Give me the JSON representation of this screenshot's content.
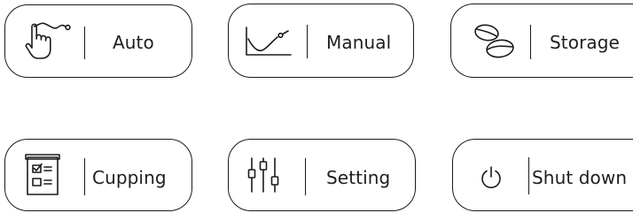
{
  "buttons": {
    "auto": {
      "label": "Auto",
      "icon": "touch-gesture-icon"
    },
    "manual": {
      "label": "Manual",
      "icon": "curve-graph-icon"
    },
    "storage": {
      "label": "Storage",
      "icon": "coffee-beans-icon"
    },
    "cupping": {
      "label": "Cupping",
      "icon": "checklist-icon"
    },
    "setting": {
      "label": "Setting",
      "icon": "sliders-icon"
    },
    "shutdown": {
      "label": "Shut down",
      "icon": "power-icon"
    }
  },
  "colors": {
    "stroke": "#1a1a1a",
    "text": "#1e1e1e",
    "background": "#ffffff"
  }
}
